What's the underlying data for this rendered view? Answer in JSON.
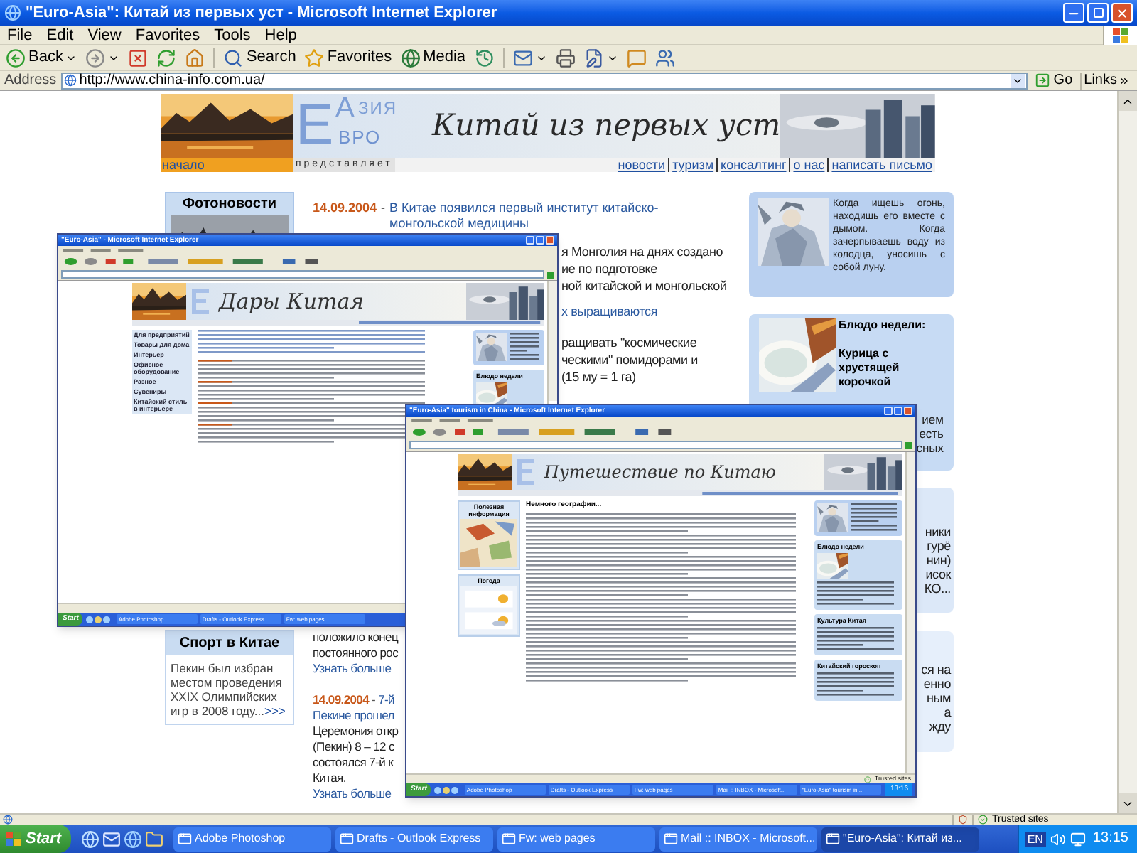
{
  "window": {
    "title": "\"Euro-Asia\": Китай из первых уст - Microsoft Internet Explorer"
  },
  "menu": [
    "File",
    "Edit",
    "View",
    "Favorites",
    "Tools",
    "Help"
  ],
  "toolbar": [
    {
      "kind": "back",
      "label": "Back"
    },
    {
      "kind": "forward"
    },
    {
      "kind": "stop"
    },
    {
      "kind": "refresh"
    },
    {
      "kind": "home"
    },
    {
      "kind": "search",
      "label": "Search"
    },
    {
      "kind": "favorites",
      "label": "Favorites"
    },
    {
      "kind": "media",
      "label": "Media"
    },
    {
      "kind": "history"
    },
    {
      "kind": "mail"
    },
    {
      "kind": "print"
    },
    {
      "kind": "edit"
    },
    {
      "kind": "discuss"
    },
    {
      "kind": "messenger"
    }
  ],
  "address": {
    "label": "Address",
    "value": "http://www.china-info.com.ua/",
    "go": "Go",
    "links": "Links"
  },
  "page": {
    "banner": {
      "home_link": "начало",
      "logo_letters": [
        "Е",
        "А"
      ],
      "logo_words": [
        "ЗИЯ",
        "ВРО"
      ],
      "title": "Китай из первых уст",
      "tagline": "представляет",
      "nav": [
        "новости",
        "туризм",
        "консалтинг",
        "о нас",
        "написать письмо"
      ]
    },
    "photo_news": {
      "title": "Фотоновости"
    },
    "sport": {
      "title": "Спорт в Китае",
      "text": "Пекин был избран местом проведения XXIX Олимпийских игр в 2008 году...",
      "more": ">>>"
    },
    "news_top": {
      "date": "14.09.2004",
      "dash": "-",
      "headline": "В Китае появился первый институт китайско-монгольской медицины"
    },
    "fragments_upper": [
      {
        "kind": "text",
        "lines": [
          "я Монголия на днях создано",
          "ие по подготовке",
          "ной китайской и монгольской"
        ]
      },
      {
        "kind": "link",
        "lines": [
          "х выращиваются"
        ]
      },
      {
        "kind": "text",
        "lines": [
          "ращивать \"космические",
          "ческими\" помидорами и",
          "(15 му = 1 га)"
        ]
      }
    ],
    "fragments_lower": [
      {
        "kind": "text",
        "text": "положило конец"
      },
      {
        "kind": "text",
        "text": "постоянного рос"
      },
      {
        "kind": "link",
        "text": "Узнать больше"
      },
      {
        "kind": "dated",
        "date": "14.09.2004",
        "dash": "-",
        "text": "7-й"
      },
      {
        "kind": "link",
        "text": "Пекине прошел"
      },
      {
        "kind": "text",
        "text": "Церемония откр"
      },
      {
        "kind": "text",
        "text": "(Пекин) 8 – 12 с"
      },
      {
        "kind": "text",
        "text": "состоялся 7-й к"
      },
      {
        "kind": "text",
        "text": "Китая."
      },
      {
        "kind": "link",
        "text": "Узнать больше"
      }
    ],
    "quote": {
      "text": "Когда ищешь огонь, находишь его вместе с дымом. Когда зачерпываешь воду из колодца, уносишь с собой луну."
    },
    "dish": {
      "title": "Блюдо недели:",
      "name": "Курица с хрустящей корочкой",
      "fragments": [
        "ием",
        "есть",
        "сных"
      ]
    },
    "side_fragments": [
      [
        "ники",
        "гурё",
        "нин)",
        "исок",
        "КО..."
      ],
      [
        "ся на",
        "енно",
        "ным",
        "а",
        "жду"
      ]
    ]
  },
  "screenshots": [
    {
      "kind": "catalog",
      "title": "\"Euro-Asia\" - Microsoft Internet Explorer",
      "banner_title": "Дары Китая",
      "sidebar": [
        "Для предприятий",
        "Товары для дома",
        "Интерьер",
        "Офисное оборудование",
        "Разное",
        "Сувениры",
        "Китайский стиль в интерьере"
      ],
      "boxes": [
        "Блюдо недели"
      ],
      "start": "Start",
      "tasks": [
        "Adobe Photoshop",
        "Drafts - Outlook Express",
        "Fw: web pages"
      ]
    },
    {
      "kind": "travel",
      "title": "\"Euro-Asia\" tourism in China - Microsoft Internet Explorer",
      "banner_title": "Путешествие по Китаю",
      "sidebar": [
        "Полезная информация",
        "Погода"
      ],
      "heading": "Немного географии...",
      "boxes": [
        "Блюдо недели",
        "Культура Китая",
        "Китайский гороскоп"
      ],
      "start": "Start",
      "tasks": [
        "Adobe Photoshop",
        "Drafts - Outlook Express",
        "Fw: web pages",
        "Mail :: INBOX - Microsoft...",
        "\"Euro-Asia\" tourism in..."
      ],
      "status": "Trusted sites",
      "clock": "13:16"
    }
  ],
  "status_bar": {
    "zone": "Trusted sites"
  },
  "taskbar": {
    "start": "Start",
    "tasks": [
      {
        "label": "Adobe Photoshop",
        "selected": false
      },
      {
        "label": "Drafts - Outlook Express",
        "selected": false
      },
      {
        "label": "Fw: web pages",
        "selected": false
      },
      {
        "label": "Mail :: INBOX - Microsoft...",
        "selected": false
      },
      {
        "label": "\"Euro-Asia\": Китай из...",
        "selected": true
      }
    ],
    "language": "EN",
    "clock": "13:15"
  }
}
